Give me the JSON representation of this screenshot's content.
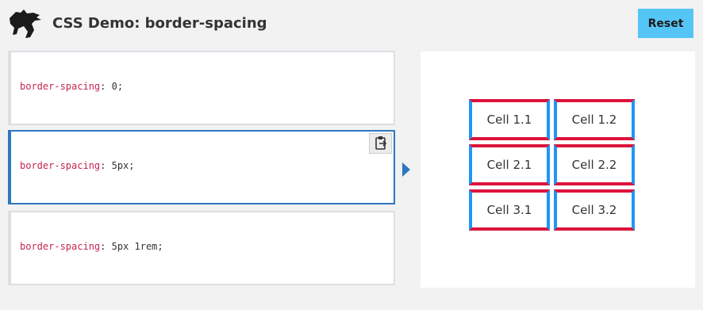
{
  "header": {
    "title": "CSS Demo: border-spacing",
    "reset_label": "Reset"
  },
  "choices": [
    {
      "property": "border-spacing",
      "value": "0",
      "selected": false
    },
    {
      "property": "border-spacing",
      "value": "5px",
      "selected": true
    },
    {
      "property": "border-spacing",
      "value": "5px 1rem",
      "selected": false
    }
  ],
  "output": {
    "table": [
      [
        "Cell 1.1",
        "Cell 1.2"
      ],
      [
        "Cell 2.1",
        "Cell 2.2"
      ],
      [
        "Cell 3.1",
        "Cell 3.2"
      ]
    ]
  },
  "colors": {
    "accent": "#2f77c0",
    "reset_bg": "#55c5f5",
    "property_text": "#c7254e",
    "cell_border_horizontal": "#dc143c",
    "cell_border_vertical": "#2196f3"
  },
  "icons": {
    "logo": "mdn-dinosaur-logo",
    "copy": "copy-to-clipboard-icon",
    "arrow": "arrow-right-icon"
  }
}
